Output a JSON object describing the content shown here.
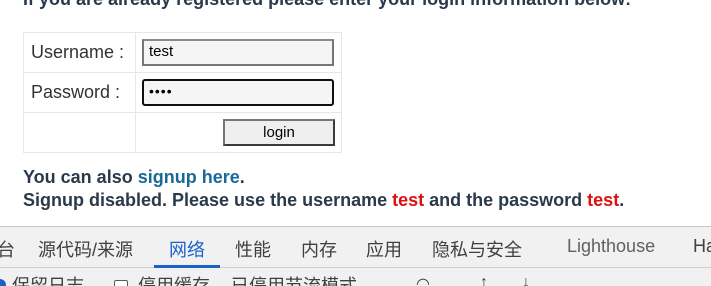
{
  "intro": {
    "text": "If you are already registered please enter your login information below:"
  },
  "form": {
    "username_label": "Username :",
    "username_value": "test",
    "password_label": "Password :",
    "password_mask": "••••",
    "login_label": "login"
  },
  "notes": {
    "line1_prefix": "You can also ",
    "signup_link": "signup here",
    "line1_suffix": ".",
    "line2_prefix": "Signup disabled. Please use the username ",
    "username_word": "test",
    "line2_middle": " and the password ",
    "password_word": "test",
    "line2_suffix": "."
  },
  "devtools": {
    "tabs": [
      {
        "label": "台"
      },
      {
        "label": "源代码/来源"
      },
      {
        "label": "网络",
        "active": true
      },
      {
        "label": "性能"
      },
      {
        "label": "内存"
      },
      {
        "label": "应用"
      },
      {
        "label": "隐私与安全"
      },
      {
        "label": "Lighthouse"
      },
      {
        "label": "Ha"
      }
    ],
    "toolbar": {
      "preserve_log": "保留日志",
      "disable_cache": "停用缓存",
      "throttle": "已停用节流模式"
    },
    "active_color": "#1a62c8"
  }
}
